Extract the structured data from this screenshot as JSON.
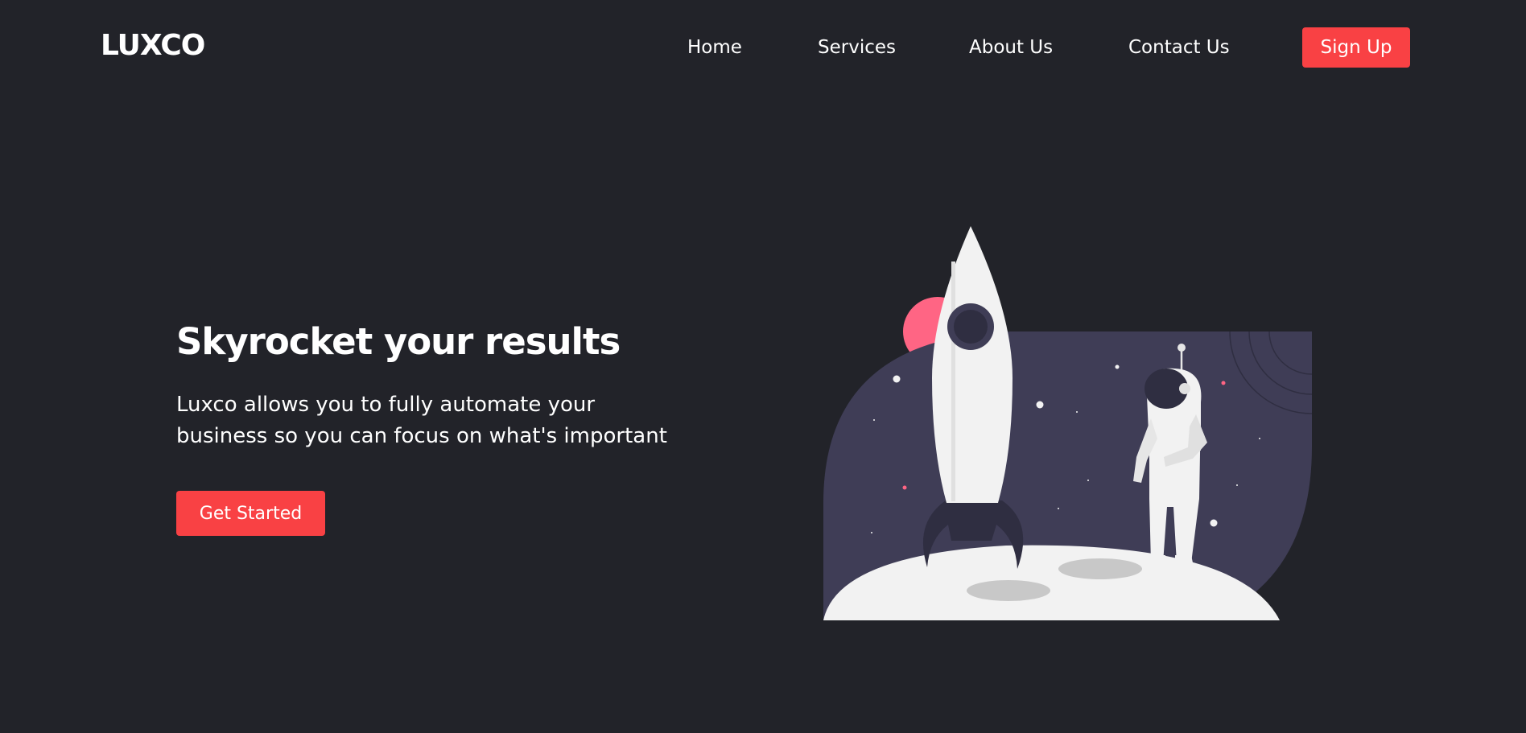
{
  "brand": {
    "logo_text": "LUXCO"
  },
  "nav": {
    "items": [
      {
        "label": "Home"
      },
      {
        "label": "Services"
      },
      {
        "label": "About Us"
      },
      {
        "label": "Contact Us"
      }
    ],
    "signup_label": "Sign Up"
  },
  "hero": {
    "title": "Skyrocket your results",
    "description": "Luxco allows you to fully automate your business so you can focus on what's important",
    "cta_label": "Get Started"
  },
  "colors": {
    "background": "#222329",
    "accent": "#f94144",
    "panel": "#3f3d56",
    "moon": "#f2f2f2",
    "planet": "#ff6584"
  },
  "illustration": {
    "icon": "rocket-astronaut-illustration"
  }
}
